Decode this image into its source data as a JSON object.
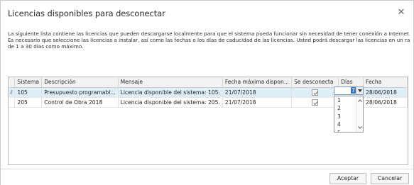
{
  "dialog": {
    "title": "Licencias disponibles para desconectar",
    "close_symbol": "✕"
  },
  "description": {
    "lines": [
      "La siguiente lista contiene las licencias que pueden descargarse localmente para que el sistema pueda funcionar sin necesidad de tener conexión a Internet.",
      "Es necesario que seleccione las licencias a instalar, así como las fechas o los días de caducidad de las licencias. Usted podrá descargar las licencias en un rango",
      "de 1 a 30 días como máximo."
    ]
  },
  "grid": {
    "columns": [
      "Sistema",
      "Descripción",
      "Mensaje",
      "Fecha máxima dispon...",
      "Se desconecta",
      "Días",
      "Fecha"
    ],
    "rows": [
      {
        "indicator": "ℓ",
        "sistema": "105",
        "descripcion": "Presupuesto programabl...",
        "mensaje": "Licencia disponible del sistema: 105.",
        "fecha_maxima": "21/07/2018",
        "se_desconecta": true,
        "dias": "",
        "fecha": "28/06/2018",
        "selected": true
      },
      {
        "indicator": "",
        "sistema": "205",
        "descripcion": "Control de Obra 2018",
        "mensaje": "Licencia disponible del sistema: 205.",
        "fecha_maxima": "21/07/2018",
        "se_desconecta": true,
        "dias": "",
        "fecha": "28/06/2018",
        "selected": false
      }
    ]
  },
  "days_editor": {
    "value": "7",
    "options": [
      "1",
      "2",
      "3",
      "4",
      "5",
      "6",
      "7"
    ]
  },
  "footer": {
    "accept_label": "Aceptar",
    "cancel_label": "Cancelar"
  },
  "colors": {
    "selected_row": "#deeef9",
    "selection_highlight": "#3a78c6"
  }
}
